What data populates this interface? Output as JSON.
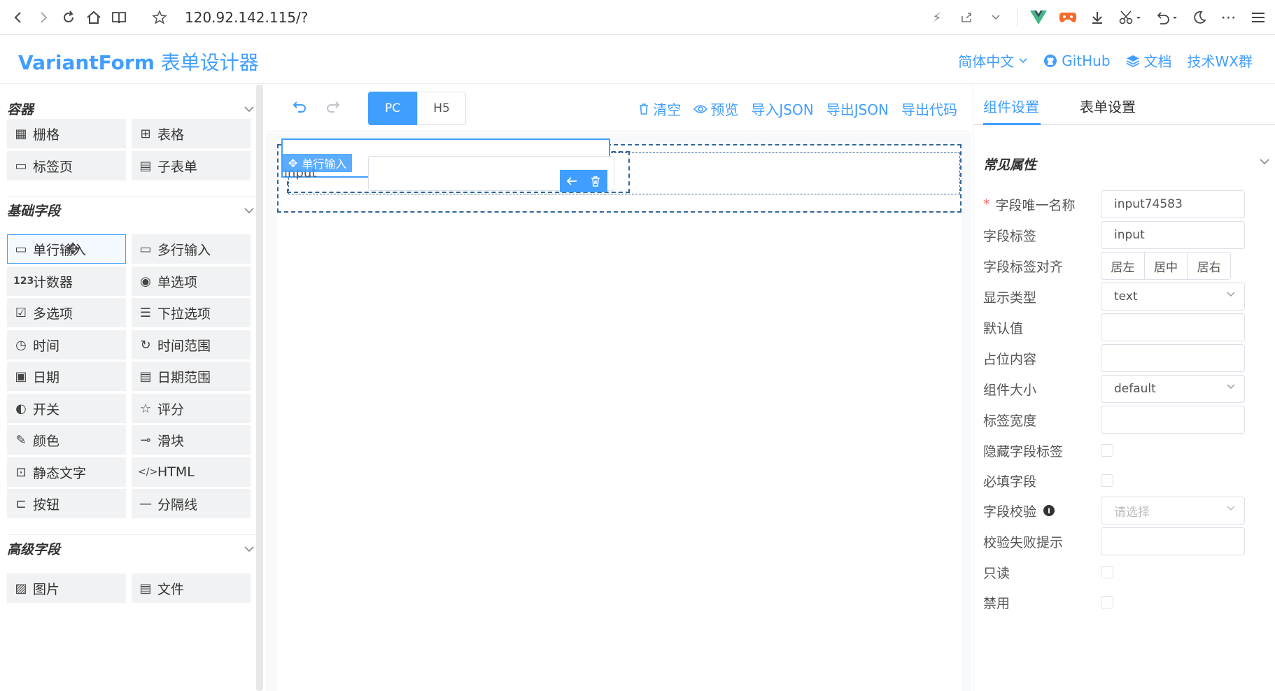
{
  "browser": {
    "url": "120.92.142.115/?",
    "nav": [
      "back",
      "forward",
      "reload",
      "home",
      "reader"
    ]
  },
  "header": {
    "brand": "VariantForm",
    "subtitle": " 表单设计器",
    "links": {
      "lang": "简体中文",
      "github": "GitHub",
      "docs": "文档",
      "wx": "技术WX群"
    }
  },
  "left": {
    "containers_title": "容器",
    "containers": [
      "栅格",
      "表格",
      "标签页",
      "子表单"
    ],
    "basic_title": "基础字段",
    "basic": [
      "单行输入",
      "多行输入",
      "计数器",
      "单选项",
      "多选项",
      "下拉选项",
      "时间",
      "时间范围",
      "日期",
      "日期范围",
      "开关",
      "评分",
      "颜色",
      "滑块",
      "静态文字",
      "HTML",
      "按钮",
      "分隔线"
    ],
    "advanced_title": "高级字段",
    "advanced": [
      "图片",
      "文件"
    ]
  },
  "toolbar": {
    "pc": "PC",
    "h5": "H5",
    "clear": "清空",
    "preview": "预览",
    "import_json": "导入JSON",
    "export_json": "导出JSON",
    "export_code": "导出代码"
  },
  "canvas": {
    "tag": "单行输入",
    "label": "input"
  },
  "right": {
    "tab_component": "组件设置",
    "tab_form": "表单设置",
    "section": "常见属性",
    "props": {
      "field_name_label": "字段唯一名称",
      "field_name_value": "input74583",
      "field_label_label": "字段标签",
      "field_label_value": "input",
      "label_align_label": "字段标签对齐",
      "align_left": "居左",
      "align_center": "居中",
      "align_right": "居右",
      "display_type_label": "显示类型",
      "display_type_value": "text",
      "default_value_label": "默认值",
      "placeholder_label": "占位内容",
      "size_label": "组件大小",
      "size_value": "default",
      "label_width_label": "标签宽度",
      "hide_label_label": "隐藏字段标签",
      "required_label": "必填字段",
      "validation_label": "字段校验",
      "validation_placeholder": "请选择",
      "validation_msg_label": "校验失败提示",
      "readonly_label": "只读",
      "disabled_label": "禁用"
    }
  },
  "colors": {
    "primary": "#409eff",
    "dashed_outline": "#336699"
  }
}
